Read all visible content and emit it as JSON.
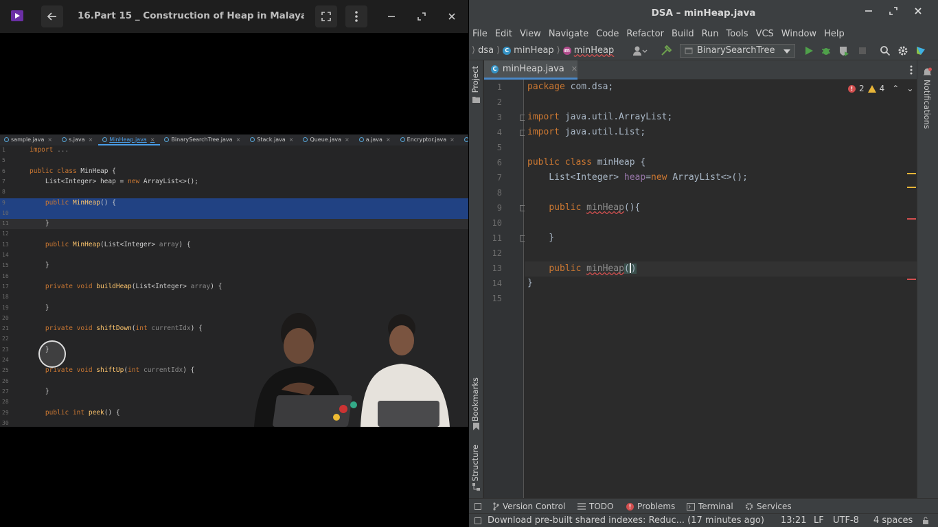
{
  "player": {
    "title": "16.Part 15 _ Construction of Heap in Malayalam _...",
    "video": {
      "tabs": [
        "sample.java",
        "s.java",
        "MinHeap.java",
        "BinarySearchTree.java",
        "Stack.java",
        "Queue.java",
        "a.java",
        "Encryptor.java",
        "SLinke"
      ],
      "active_tab": "MinHeap.java",
      "lines": [
        {
          "n": "1",
          "text": "import ..."
        },
        {
          "n": "5",
          "text": ""
        },
        {
          "n": "6",
          "text": "public class MinHeap {"
        },
        {
          "n": "7",
          "text": "    List<Integer> heap = new ArrayList<>();"
        },
        {
          "n": "8",
          "text": ""
        },
        {
          "n": "9",
          "text": "    public MinHeap() {"
        },
        {
          "n": "10",
          "text": ""
        },
        {
          "n": "11",
          "text": "    }"
        },
        {
          "n": "12",
          "text": ""
        },
        {
          "n": "13",
          "text": "    public MinHeap(List<Integer> array) {"
        },
        {
          "n": "14",
          "text": ""
        },
        {
          "n": "15",
          "text": "    }"
        },
        {
          "n": "16",
          "text": ""
        },
        {
          "n": "17",
          "text": "    private void buildHeap(List<Integer> array) {"
        },
        {
          "n": "18",
          "text": ""
        },
        {
          "n": "19",
          "text": "    }"
        },
        {
          "n": "20",
          "text": ""
        },
        {
          "n": "21",
          "text": "    private void shiftDown(int currentIdx) {"
        },
        {
          "n": "22",
          "text": ""
        },
        {
          "n": "23",
          "text": "    }"
        },
        {
          "n": "24",
          "text": ""
        },
        {
          "n": "25",
          "text": "    private void shiftUp(int currentIdx) {"
        },
        {
          "n": "26",
          "text": ""
        },
        {
          "n": "27",
          "text": "    }"
        },
        {
          "n": "28",
          "text": ""
        },
        {
          "n": "29",
          "text": "    public int peek() {"
        },
        {
          "n": "30",
          "text": ""
        }
      ]
    }
  },
  "ide": {
    "window_title": "DSA – minHeap.java",
    "menu": [
      "File",
      "Edit",
      "View",
      "Navigate",
      "Code",
      "Refactor",
      "Build",
      "Run",
      "Tools",
      "VCS",
      "Window",
      "Help"
    ],
    "breadcrumb": {
      "project": "dsa",
      "class": "minHeap",
      "method": "minHeap"
    },
    "run_config": "BinarySearchTree",
    "left_tools": {
      "project": "Project",
      "bookmarks": "Bookmarks",
      "structure": "Structure"
    },
    "right_tools": {
      "notifications": "Notifications"
    },
    "editor_tab": "minHeap.java",
    "inspections": {
      "errors": "2",
      "warnings": "4"
    },
    "code_lines": [
      {
        "n": "1",
        "text": "package com.dsa;"
      },
      {
        "n": "2",
        "text": ""
      },
      {
        "n": "3",
        "text": "import java.util.ArrayList;"
      },
      {
        "n": "4",
        "text": "import java.util.List;"
      },
      {
        "n": "5",
        "text": ""
      },
      {
        "n": "6",
        "text": "public class minHeap {"
      },
      {
        "n": "7",
        "text": "    List<Integer> heap=new ArrayList<>();"
      },
      {
        "n": "8",
        "text": ""
      },
      {
        "n": "9",
        "text": "    public minHeap(){"
      },
      {
        "n": "10",
        "text": ""
      },
      {
        "n": "11",
        "text": "    }"
      },
      {
        "n": "12",
        "text": ""
      },
      {
        "n": "13",
        "text": "    public minHeap()"
      },
      {
        "n": "14",
        "text": "}"
      },
      {
        "n": "15",
        "text": ""
      }
    ],
    "toolwindows": {
      "version_control": "Version Control",
      "todo": "TODO",
      "problems": "Problems",
      "terminal": "Terminal",
      "services": "Services"
    },
    "status": {
      "message": "Download pre-built shared indexes: Reduc... (17 minutes ago)",
      "position": "13:21",
      "line_sep": "LF",
      "encoding": "UTF-8",
      "indent": "4 spaces"
    },
    "colors": {
      "keyword": "#cc7832",
      "field": "#9876aa",
      "error": "#d24f4f",
      "warning": "#e8b538",
      "accent": "#4a88c7"
    }
  }
}
